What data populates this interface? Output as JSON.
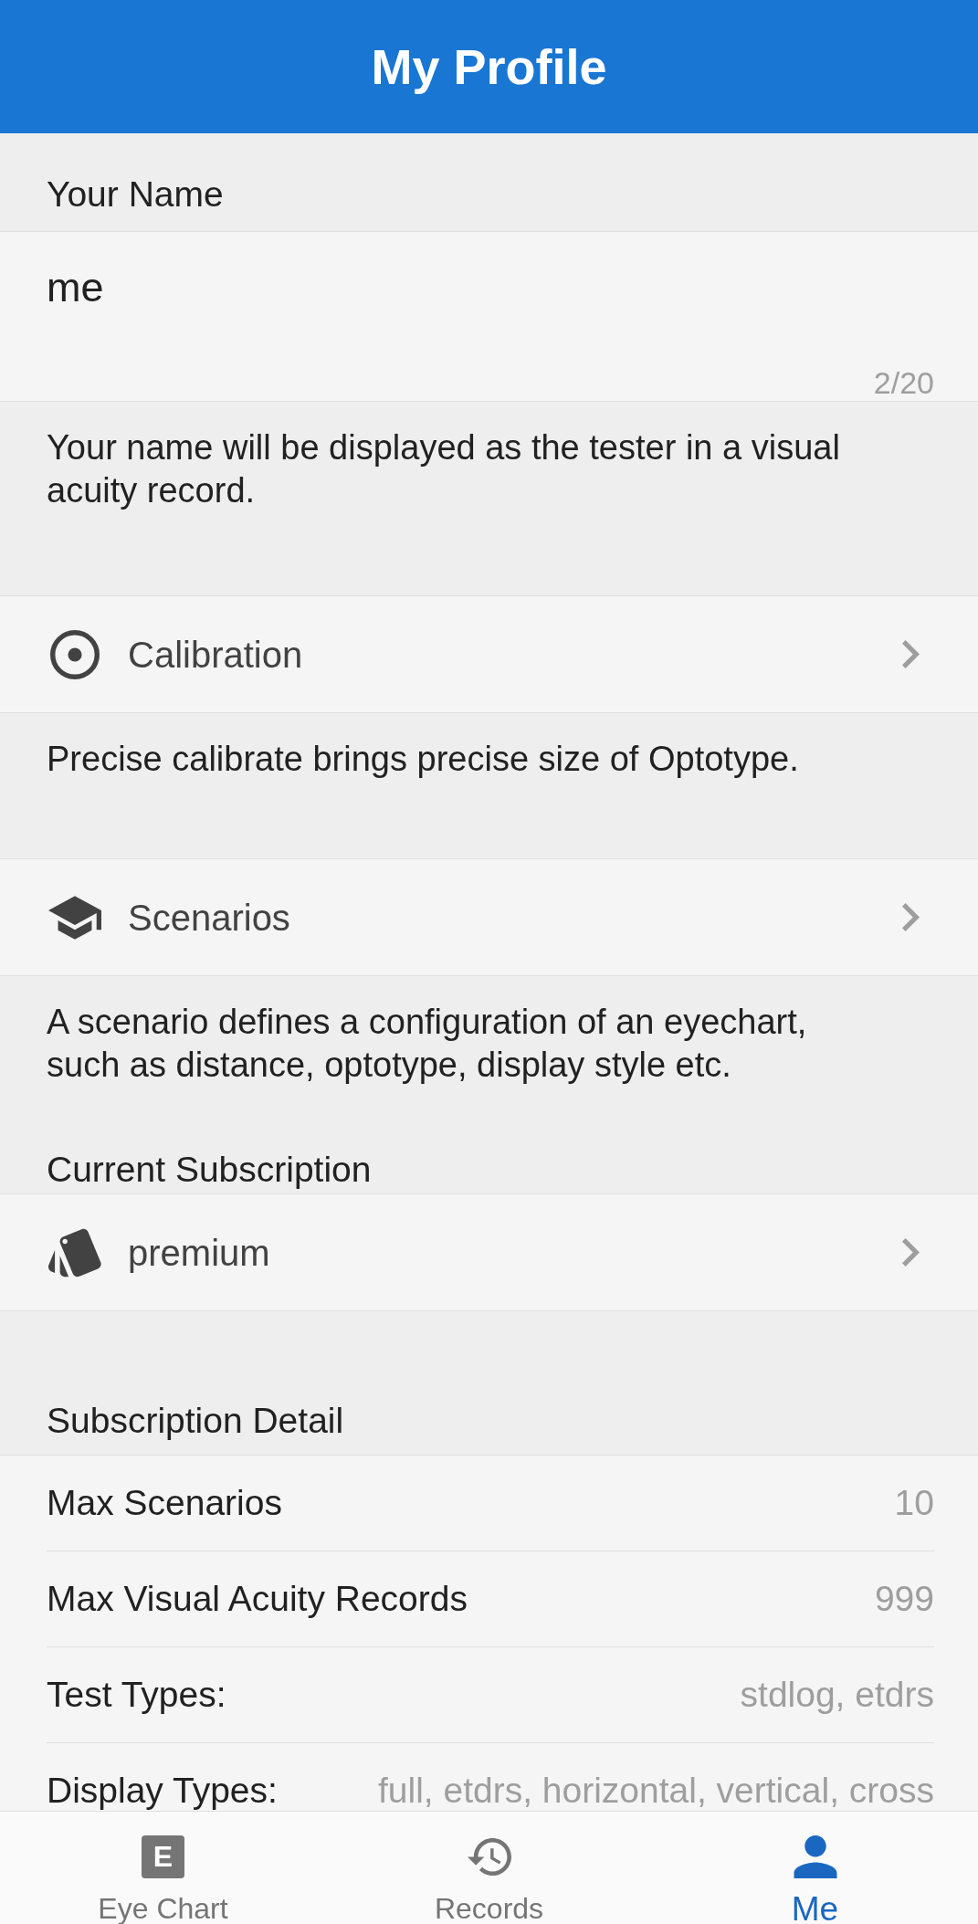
{
  "app_bar": {
    "title": "My Profile"
  },
  "name_section": {
    "label": "Your Name",
    "value": "me",
    "counter": "2/20",
    "help": "Your name will be displayed as the tester in a visual acuity record."
  },
  "settings": [
    {
      "label": "Calibration",
      "description": "Precise calibrate brings precise size of Optotype."
    },
    {
      "label": "Scenarios",
      "description": "A scenario defines a configuration of an eyechart, such as distance, optotype, display style etc."
    }
  ],
  "subscription": {
    "label": "Current Subscription",
    "plan": "premium"
  },
  "subscription_detail": {
    "label": "Subscription Detail",
    "rows": [
      {
        "label": "Max Scenarios",
        "value": "10"
      },
      {
        "label": "Max Visual Acuity Records",
        "value": "999"
      },
      {
        "label": "Test Types:",
        "value": "stdlog, etdrs"
      },
      {
        "label": "Display Types:",
        "value": "full, etdrs, horizontal, vertical, cross"
      }
    ]
  },
  "bottom_nav": [
    {
      "label": "Eye Chart",
      "icon_text": "E",
      "selected": false
    },
    {
      "label": "Records",
      "selected": false
    },
    {
      "label": "Me",
      "selected": true
    }
  ]
}
